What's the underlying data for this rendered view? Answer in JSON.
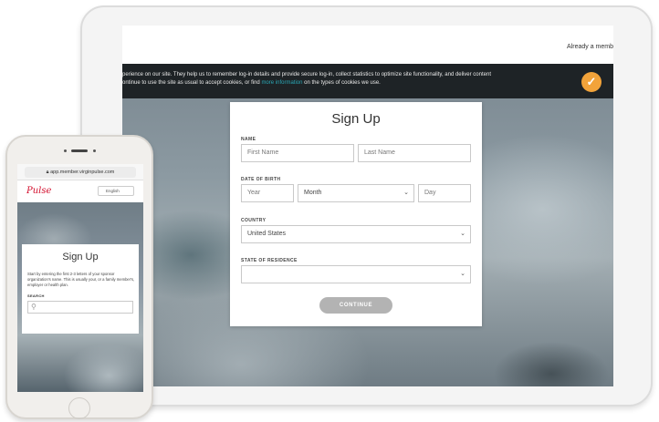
{
  "tablet": {
    "header_link": "Already a memb",
    "cookie": {
      "text_before_link": "perience on our site. They help us to remember log-in details and provide secure log-in, collect statistics to optimize site functionality, and deliver content",
      "text_line2_before": "ontinue to use the site as usual to accept cookies, or find ",
      "link": "more information",
      "text_after_link": " on the types of cookies we use.",
      "accept_icon": "check-icon"
    },
    "form": {
      "title": "Sign Up",
      "name_label": "NAME",
      "first_name_placeholder": "First Name",
      "last_name_placeholder": "Last Name",
      "dob_label": "DATE OF BIRTH",
      "year_placeholder": "Year",
      "month_value": "Month",
      "day_placeholder": "Day",
      "country_label": "COUNTRY",
      "country_value": "United States",
      "state_label": "STATE OF RESIDENCE",
      "state_value": "",
      "continue_label": "CONTINUE"
    }
  },
  "phone": {
    "url": "app.member.virginpulse.com",
    "logo_text": "Pulse",
    "language": "English",
    "form": {
      "title": "Sign Up",
      "description": "Start by entering the first 2-3 letters of your sponsor organization's name. This is usually your, or a family member's, employer or health plan.",
      "search_label": "SEARCH",
      "search_placeholder": ""
    }
  },
  "colors": {
    "accent_orange": "#f2a33a",
    "link_teal": "#2aa7b5",
    "brand_red": "#d3102e",
    "button_gray": "#b3b3b3"
  }
}
